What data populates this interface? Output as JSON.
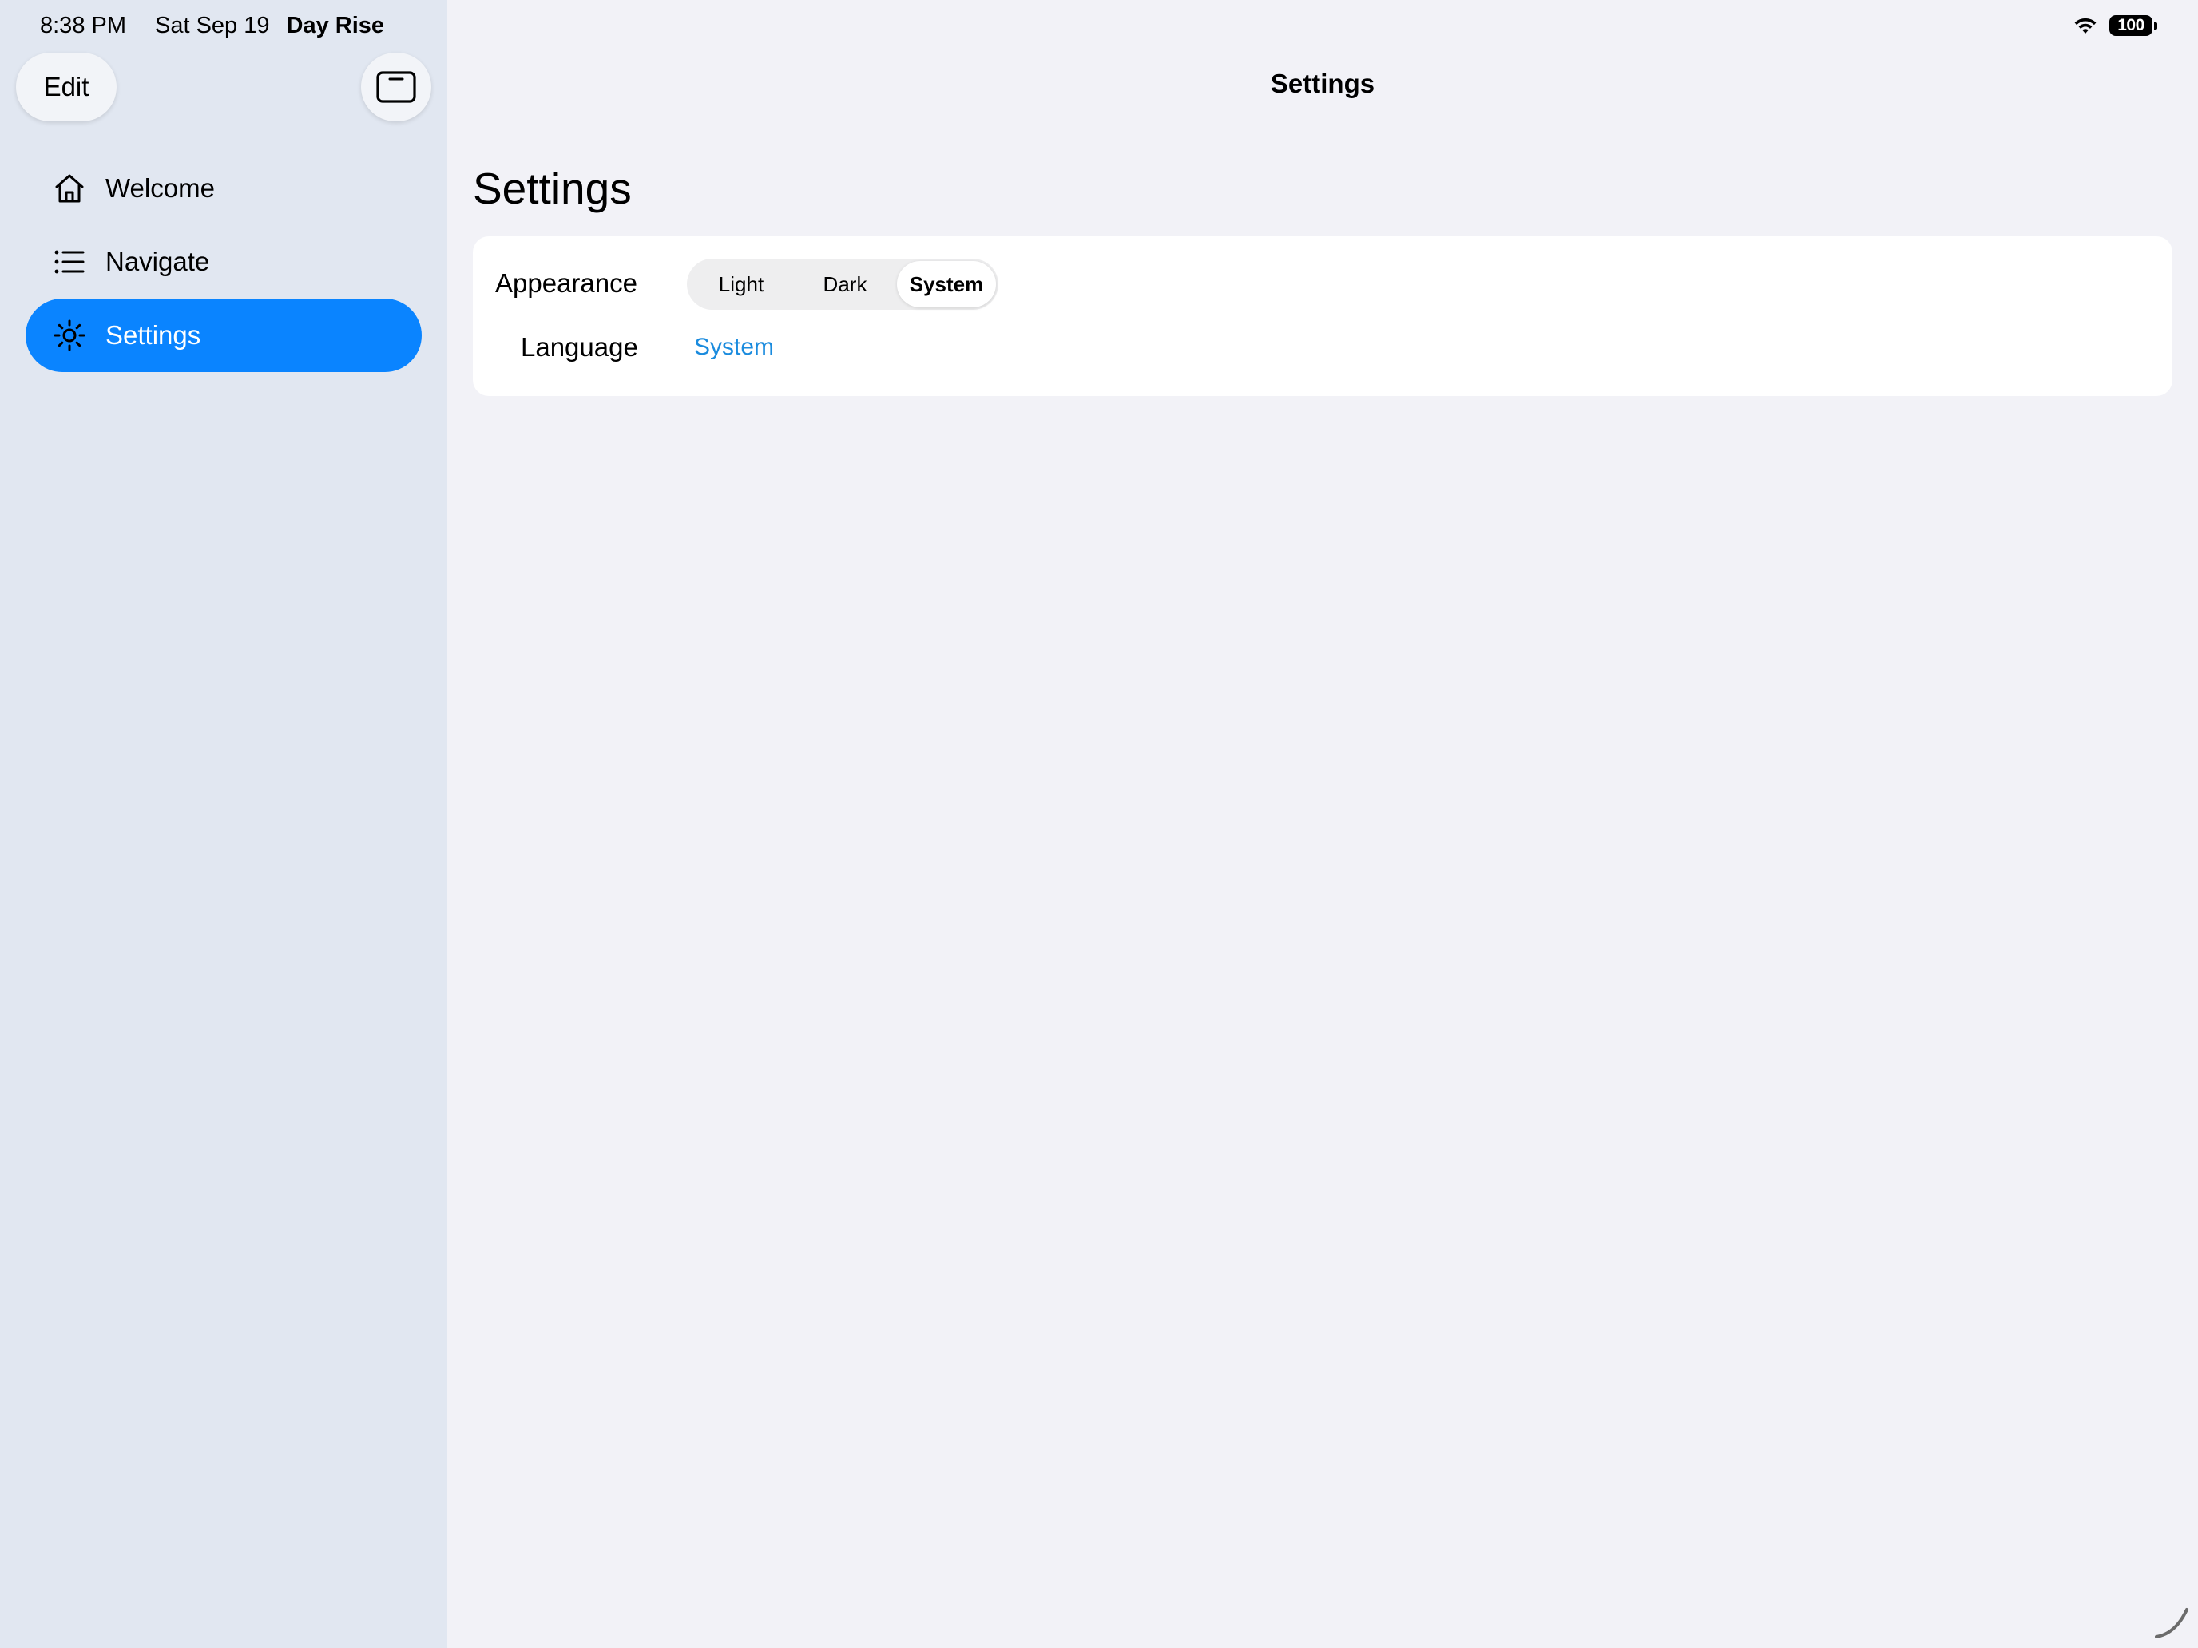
{
  "status_bar": {
    "time": "8:38 PM",
    "date": "Sat Sep 19",
    "app_name": "Day Rise",
    "battery": "100"
  },
  "sidebar": {
    "edit_label": "Edit",
    "toggle_icon": "sidebar-toggle-icon",
    "items": [
      {
        "label": "Welcome",
        "icon": "house-icon",
        "selected": false
      },
      {
        "label": "Navigate",
        "icon": "list-icon",
        "selected": false
      },
      {
        "label": "Settings",
        "icon": "sun-icon",
        "selected": true
      }
    ]
  },
  "main": {
    "nav_title": "Settings",
    "large_title": "Settings",
    "appearance": {
      "label": "Appearance",
      "options": [
        "Light",
        "Dark",
        "System"
      ],
      "selected": "System"
    },
    "language": {
      "label": "Language",
      "value": "System"
    }
  },
  "colors": {
    "accent": "#0a84ff",
    "link": "#1a8bde",
    "sidebar_bg": "#e1e7f1",
    "main_bg": "#f2f2f7"
  }
}
